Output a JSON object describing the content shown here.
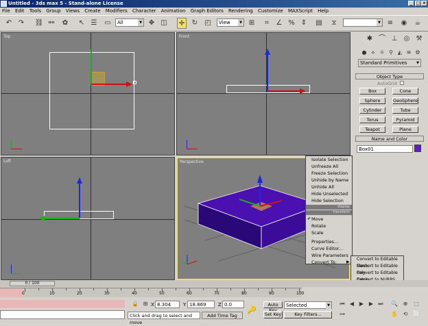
{
  "app": {
    "title": "Untitled - 3ds max 5 - Stand-alone License"
  },
  "window_controls": {
    "minimize": "_",
    "maximize": "□",
    "close": "×"
  },
  "menu": [
    "File",
    "Edit",
    "Tools",
    "Group",
    "Views",
    "Create",
    "Modifiers",
    "Character",
    "Animation",
    "Graph Editors",
    "Rendering",
    "Customize",
    "MAXScript",
    "Help"
  ],
  "toolbar": {
    "filter_value": "All",
    "view_value": "View",
    "named_sel_value": ""
  },
  "viewports": {
    "top": "Top",
    "front": "Front",
    "left": "Left",
    "perspective": "Perspective"
  },
  "command_panel": {
    "category_value": "Standard Primitives",
    "object_type_header": "Object Type",
    "autogrid_label": "AutoGrid",
    "primitive_buttons": [
      "Box",
      "Cone",
      "Sphere",
      "GeoSphere",
      "Cylinder",
      "Tube",
      "Torus",
      "Pyramid",
      "Teapot",
      "Plane"
    ],
    "name_color_header": "Name and Color",
    "object_name": "Box01",
    "object_color": "#6020b8"
  },
  "quad_menu": {
    "display_items": [
      "Isolate Selection",
      "Unfreeze All",
      "Freeze Selection",
      "Unhide by Name",
      "Unhide All",
      "Hide Unselected",
      "Hide Selection"
    ],
    "display_label": "display",
    "transform_label": "transform",
    "transform_items": [
      "Move",
      "Rotate",
      "Scale",
      "Properties...",
      "Curve Editor...",
      "Wire Parameters",
      "Convert To:"
    ],
    "checked_item": "Move"
  },
  "convert_submenu": [
    "Convert to Editable Mesh",
    "Convert to Editable Poly",
    "Convert to Editable Patch",
    "Convert to NURBS"
  ],
  "timeline": {
    "slider_label": "0 / 100",
    "ticks": [
      "0",
      "10",
      "20",
      "30",
      "40",
      "50",
      "60",
      "70",
      "80",
      "90",
      "100"
    ]
  },
  "status": {
    "x_label": "X",
    "x_value": "8.304",
    "y_label": "Y",
    "y_value": "18.869",
    "z_label": "Z",
    "z_value": "0.0",
    "auto_key": "Auto Key",
    "set_key": "Set Key",
    "key_mode_value": "Selected",
    "key_filters": "Key Filters...",
    "prompt": "Click and drag to select and move",
    "add_time_tag": "Add Time Tag"
  },
  "colors": {
    "viewport_bg": "#7f7f7f",
    "active_border": "#f0e060",
    "box_purple": "#4a10b0",
    "selection_white": "#ffffff"
  }
}
